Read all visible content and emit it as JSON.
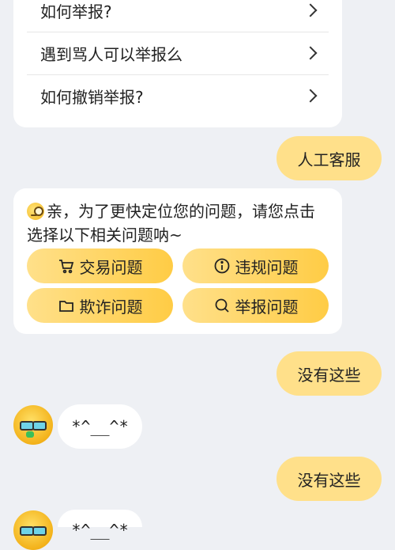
{
  "faq": {
    "items": [
      {
        "label": "如何举报?"
      },
      {
        "label": "遇到骂人可以举报么"
      },
      {
        "label": "如何撤销举报?"
      }
    ]
  },
  "chat": {
    "user_message_1": "人工客服",
    "prompt": "亲，为了更快定位您的问题，请您点击选择以下相关问题呐~",
    "categories": [
      {
        "label": "交易问题",
        "icon": "cart-icon"
      },
      {
        "label": "违规问题",
        "icon": "info-icon"
      },
      {
        "label": "欺诈问题",
        "icon": "folder-icon"
      },
      {
        "label": "举报问题",
        "icon": "search-icon"
      }
    ],
    "user_message_2": "没有这些",
    "bot_reply_1": "*^__^*",
    "user_message_3": "没有这些",
    "bot_reply_2": "*^__^*"
  },
  "colors": {
    "accent": "#ffd24d",
    "background": "#eef0f4",
    "card": "#ffffff"
  }
}
